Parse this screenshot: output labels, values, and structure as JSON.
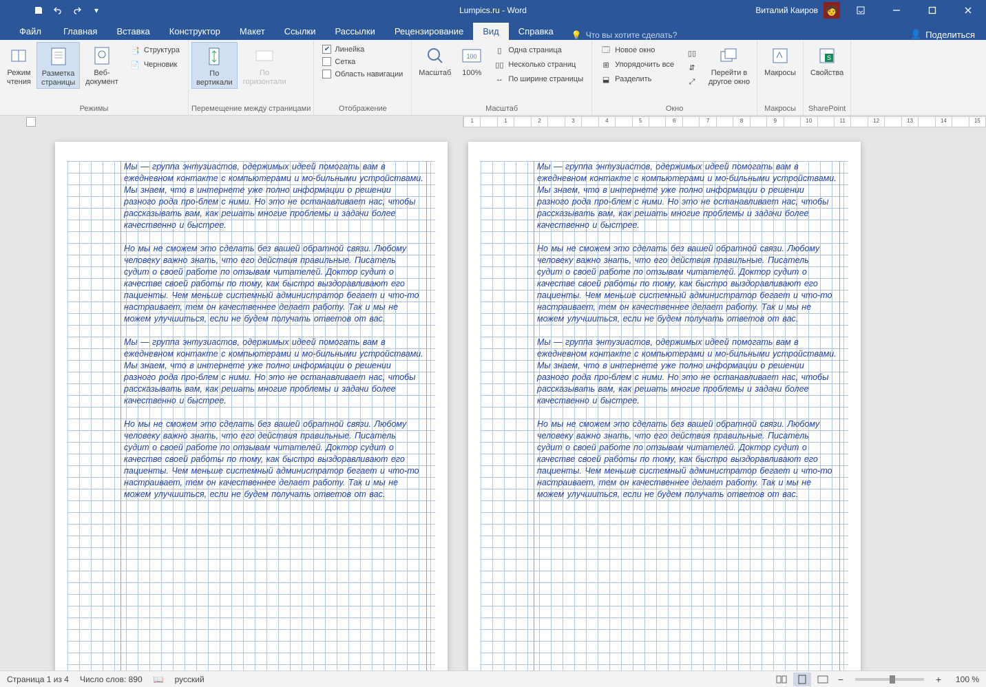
{
  "titlebar": {
    "title": "Lumpics.ru  -  Word",
    "user": "Виталий Каиров"
  },
  "tabs": {
    "file": "Файл",
    "home": "Главная",
    "insert": "Вставка",
    "design": "Конструктор",
    "layout": "Макет",
    "references": "Ссылки",
    "mailings": "Рассылки",
    "review": "Рецензирование",
    "view": "Вид",
    "help": "Справка",
    "tellme": "Что вы хотите сделать?",
    "share": "Поделиться"
  },
  "ribbon": {
    "modes": {
      "read": "Режим\nчтения",
      "print": "Разметка\nстраницы",
      "web": "Веб-\nдокумент",
      "outline": "Структура",
      "draft": "Черновик",
      "label": "Режимы"
    },
    "pagemove": {
      "vertical": "По\nвертикали",
      "horizontal": "По\nгоризонтали",
      "label": "Перемещение между страницами"
    },
    "show": {
      "ruler": "Линейка",
      "grid": "Сетка",
      "navpane": "Область навигации",
      "label": "Отображение"
    },
    "zoom": {
      "zoom": "Масштаб",
      "hundred": "100%",
      "onepage": "Одна страница",
      "multipage": "Несколько страниц",
      "pagewidth": "По ширине страницы",
      "label": "Масштаб"
    },
    "window": {
      "newwin": "Новое окно",
      "arrange": "Упорядочить все",
      "split": "Разделить",
      "switch": "Перейти в\nдругое окно",
      "label": "Окно"
    },
    "macros": {
      "label": "Макросы",
      "btn": "Макросы"
    },
    "sharepoint": {
      "label": "SharePoint",
      "btn": "Свойства"
    }
  },
  "ruler_marks": [
    "1",
    "",
    "1",
    "",
    "2",
    "",
    "3",
    "",
    "4",
    "",
    "5",
    "",
    "6",
    "",
    "7",
    "",
    "8",
    "",
    "9",
    "",
    "10",
    "",
    "11",
    "",
    "12",
    "",
    "13",
    "",
    "14",
    "",
    "15"
  ],
  "document": {
    "p1": "Мы — группа энтузиастов, одержимых идеей помогать вам в ежедневном контакте с компьютерами и мо-бильными устройствами. Мы знаем, что в интернете уже полно информации о решении разного рода про-блем с ними. Но это не останавливает нас, чтобы рассказывать вам, как решать многие проблемы и задачи более качественно и быстрее.",
    "p2": "Но мы не сможем это сделать без вашей обратной связи. Любому человеку важно знать, что его действия правильные. Писатель судит о своей работе по отзывам читателей. Доктор судит о качестве своей работы по тому, как быстро выздоравливают его пациенты. Чем меньше системный администратор бегает и что-то настраивает, тем он качественнее делает работу. Так и мы не можем улучшиться, если не будем получать ответов от вас."
  },
  "status": {
    "page": "Страница 1 из 4",
    "words": "Число слов: 890",
    "lang": "русский",
    "zoom": "100 %"
  }
}
